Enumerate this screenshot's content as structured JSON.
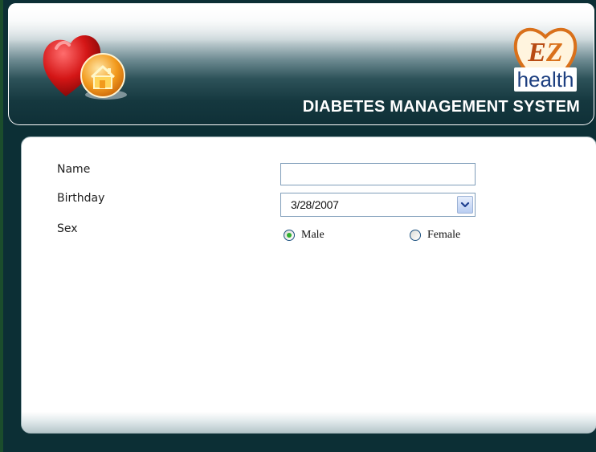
{
  "header": {
    "title": "DIABETES MANAGEMENT SYSTEM",
    "logo_text": "EZ health",
    "home_icon": "home-heart-icon"
  },
  "form": {
    "name": {
      "label": "Name",
      "value": ""
    },
    "birthday": {
      "label": "Birthday",
      "value": "3/28/2007",
      "dropdown_icon": "chevron-down-icon"
    },
    "sex": {
      "label": "Sex",
      "options": [
        {
          "label": "Male",
          "checked": true
        },
        {
          "label": "Female",
          "checked": false
        }
      ]
    }
  },
  "colors": {
    "header_dark": "#0f3037",
    "frame": "#0c2f35",
    "title_text": "#ffffff",
    "radio_checked": "#2fb02f",
    "input_border": "#7f9db9"
  }
}
